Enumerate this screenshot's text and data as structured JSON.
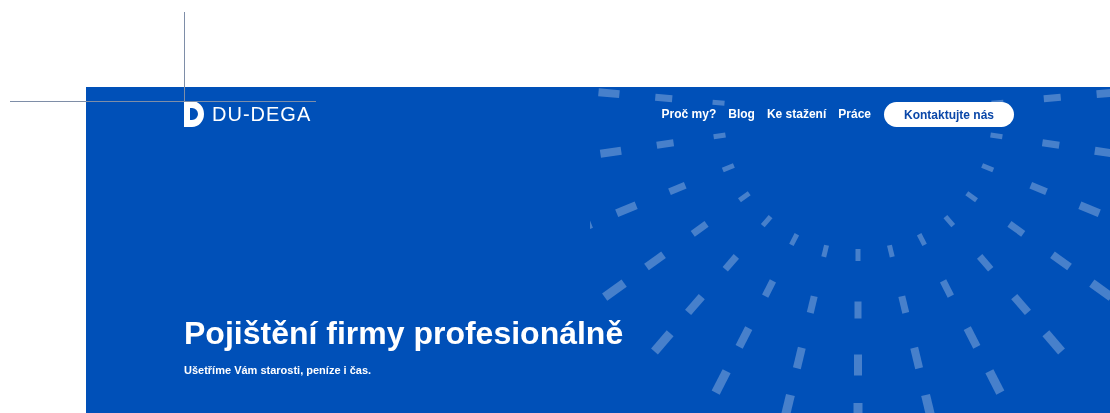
{
  "logo": {
    "text": "DU-DEGA"
  },
  "nav": [
    {
      "label": "Proč my?"
    },
    {
      "label": "Blog"
    },
    {
      "label": "Ke stažení"
    },
    {
      "label": "Práce"
    }
  ],
  "cta_button": {
    "label": "Kontaktujte nás"
  },
  "hero": {
    "title": "Pojištění firmy profesionálně",
    "subtitle": "Ušetříme Vám starosti, peníze i čas."
  }
}
